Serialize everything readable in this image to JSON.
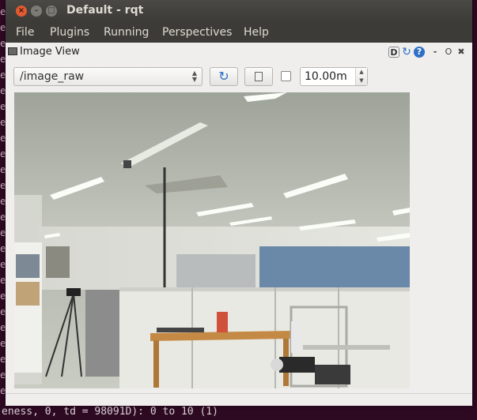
{
  "window": {
    "title": "Default - rqt"
  },
  "menubar": {
    "items": [
      "File",
      "Plugins",
      "Running",
      "Perspectives",
      "Help"
    ]
  },
  "panel": {
    "title": "Image View",
    "d_label": "D",
    "help_label": "?",
    "minus_label": "-",
    "float_label": "O",
    "close_label": "✖"
  },
  "toolbar": {
    "topic_value": "/image_raw",
    "timeout_value": "10.00m",
    "checkbox_checked": false
  },
  "terminal": {
    "bottom_text": "eness, 0, td = 98091D): 0 to 10 (1)",
    "left_strip": [
      "e",
      "e",
      "e",
      "e",
      "e",
      "e",
      "e",
      "e",
      "e",
      "e",
      "e",
      "e",
      "e",
      "e",
      "e",
      "e",
      "e",
      "e",
      "e",
      "e",
      "e",
      "e",
      "e",
      "e",
      "e"
    ]
  },
  "icons": {
    "close": "close-icon",
    "minimize": "minimize-icon",
    "maximize": "maximize-icon",
    "refresh": "refresh-icon",
    "save": "save-icon",
    "help": "help-icon"
  },
  "colors": {
    "titlebar": "#3c3b37",
    "close_button": "#e35a30",
    "refresh_blue": "#2a6dc9"
  }
}
